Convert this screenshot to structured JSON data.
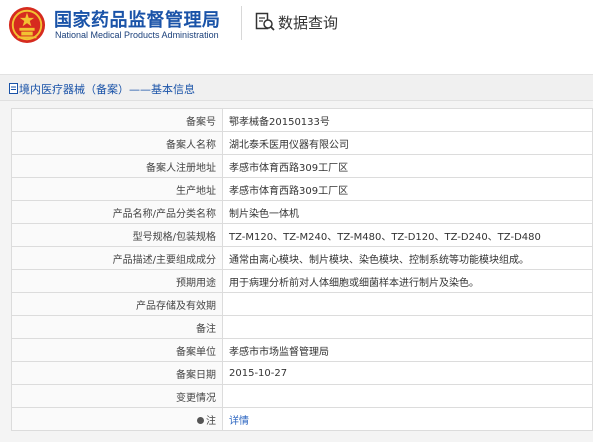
{
  "header": {
    "org_name_cn": "国家药品监督管理局",
    "org_name_en": "National Medical Products Administration",
    "search_title": "数据查询",
    "brand_color": "#1a53a8"
  },
  "panel": {
    "title": "境内医疗器械（备案）——基本信息"
  },
  "rows": [
    {
      "label": "备案号",
      "value": "鄂孝械备20150133号"
    },
    {
      "label": "备案人名称",
      "value": "湖北泰禾医用仪器有限公司"
    },
    {
      "label": "备案人注册地址",
      "value": "孝感市体育西路309工厂区"
    },
    {
      "label": "生产地址",
      "value": "孝感市体育西路309工厂区"
    },
    {
      "label": "产品名称/产品分类名称",
      "value": "制片染色一体机"
    },
    {
      "label": "型号规格/包装规格",
      "value": "TZ-M120、TZ-M240、TZ-M480、TZ-D120、TZ-D240、TZ-D480"
    },
    {
      "label": "产品描述/主要组成成分",
      "value": "通常由离心模块、制片模块、染色模块、控制系统等功能模块组成。"
    },
    {
      "label": "预期用途",
      "value": "用于病理分析前对人体细胞或细菌样本进行制片及染色。"
    },
    {
      "label": "产品存储及有效期",
      "value": ""
    },
    {
      "label": "备注",
      "value": ""
    },
    {
      "label": "备案单位",
      "value": "孝感市市场监督管理局"
    },
    {
      "label": "备案日期",
      "value": "2015-10-27"
    },
    {
      "label": "变更情况",
      "value": ""
    },
    {
      "label": "注",
      "value": "详情"
    }
  ]
}
